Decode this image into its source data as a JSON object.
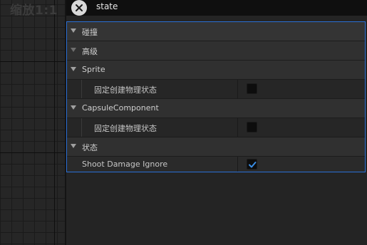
{
  "viewport": {
    "zoom_label": "缩放1:1"
  },
  "search": {
    "value": "state",
    "close_icon": "close-icon"
  },
  "details": {
    "rows": [
      {
        "type": "category",
        "label": "碰撞"
      },
      {
        "type": "category",
        "label": "高级"
      },
      {
        "type": "category",
        "label": "Sprite"
      },
      {
        "type": "property",
        "label": "固定创建物理状态",
        "checked": false
      },
      {
        "type": "category",
        "label": "CapsuleComponent"
      },
      {
        "type": "property",
        "label": "固定创建物理状态",
        "checked": false
      },
      {
        "type": "category",
        "label": "状态"
      },
      {
        "type": "property",
        "label": "Shoot Damage Ignore",
        "checked": true
      }
    ]
  },
  "colors": {
    "accent": "#2a6fd6",
    "check": "#3a8ee6"
  }
}
